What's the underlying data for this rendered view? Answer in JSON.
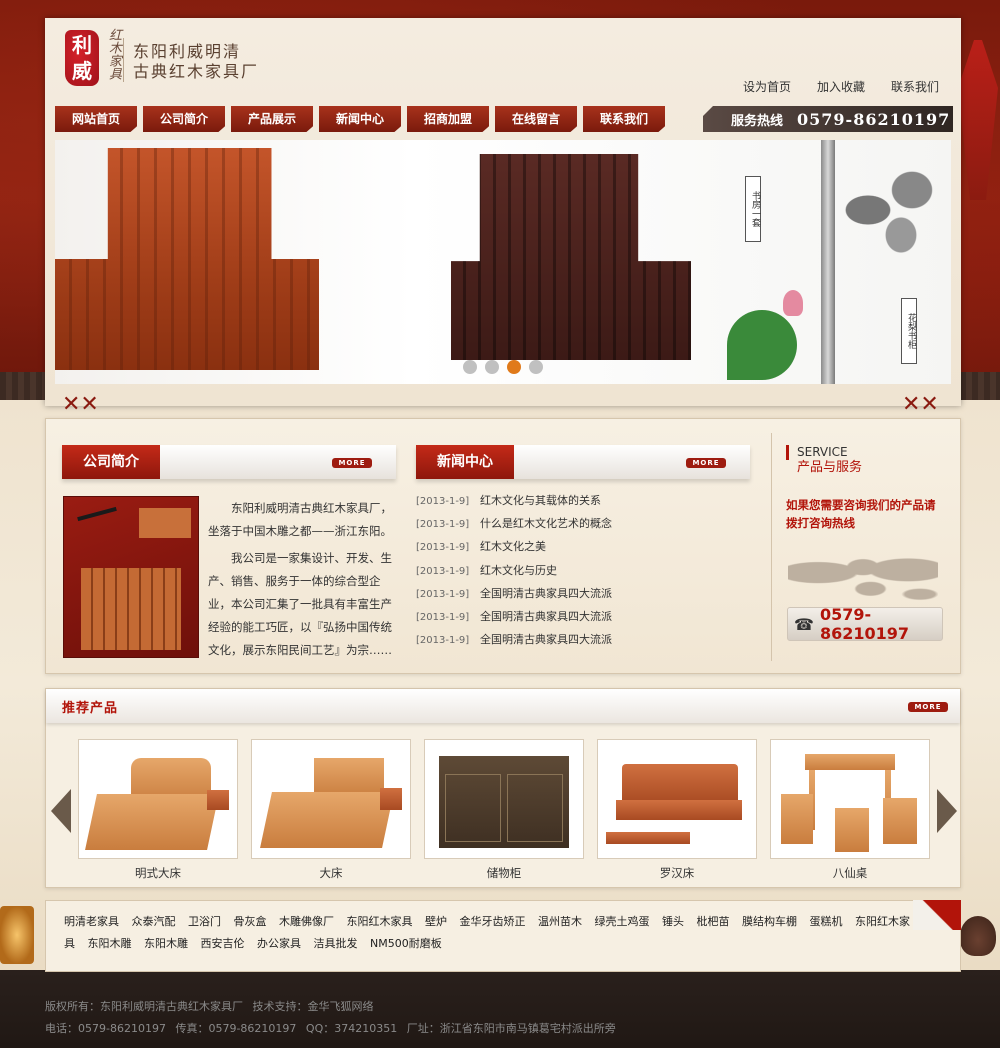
{
  "colors": {
    "accent": "#b2140a",
    "nav_red": "#8e170c",
    "page_bg": "#f1e6d2",
    "footer_bg": "#231a16"
  },
  "brand": {
    "seal_text": "利威",
    "script_text": "红木家具",
    "line1": "东阳利威明清",
    "line2": "古典红木家具厂"
  },
  "top_links": [
    "设为首页",
    "加入收藏",
    "联系我们"
  ],
  "nav": [
    "网站首页",
    "公司简介",
    "产品展示",
    "新闻中心",
    "招商加盟",
    "在线留言",
    "联系我们"
  ],
  "hotline": {
    "label": "服务热线",
    "number": "0579-86210197"
  },
  "banner": {
    "tag1": "书房一套",
    "tag2": "花梨书柜",
    "dots": 4,
    "active_dot": 3
  },
  "about": {
    "title": "公司简介",
    "more": "MORE",
    "para1": "东阳利威明清古典红木家具厂，坐落于中国木雕之都——浙江东阳。",
    "para2": "我公司是一家集设计、开发、生产、销售、服务于一体的综合型企业，本公司汇集了一批具有丰富生产经验的能工巧匠，以『弘扬中国传统文化，展示东阳民间工艺』为宗……"
  },
  "news": {
    "title": "新闻中心",
    "more": "MORE",
    "items": [
      {
        "date": "[2013-1-9]",
        "title": "红木文化与其载体的关系"
      },
      {
        "date": "[2013-1-9]",
        "title": "什么是红木文化艺术的概念"
      },
      {
        "date": "[2013-1-9]",
        "title": "红木文化之美"
      },
      {
        "date": "[2013-1-9]",
        "title": "红木文化与历史"
      },
      {
        "date": "[2013-1-9]",
        "title": "全国明清古典家具四大流派"
      },
      {
        "date": "[2013-1-9]",
        "title": "全国明清古典家具四大流派"
      },
      {
        "date": "[2013-1-9]",
        "title": "全国明清古典家具四大流派"
      }
    ]
  },
  "service": {
    "en": "SERVICE",
    "cn": "产品与服务",
    "consult": "如果您需要咨询我们的产品请拨打咨询热线",
    "phone": "0579-86210197"
  },
  "products": {
    "title": "推荐产品",
    "more": "MORE",
    "items": [
      {
        "name": "明式大床",
        "icon": "bed-icon"
      },
      {
        "name": "大床",
        "icon": "bed-icon"
      },
      {
        "name": "储物柜",
        "icon": "cabinet-icon"
      },
      {
        "name": "罗汉床",
        "icon": "daybed-icon"
      },
      {
        "name": "八仙桌",
        "icon": "table-icon"
      }
    ]
  },
  "links": [
    "明清老家具",
    "众泰汽配",
    "卫浴门",
    "骨灰盒",
    "木雕佛像厂",
    "东阳红木家具",
    "壁炉",
    "金华牙齿矫正",
    "温州苗木",
    "绿壳土鸡蛋",
    "锤头",
    "枇杷苗",
    "膜结构车棚",
    "蛋糕机",
    "东阳红木家具",
    "东阳木雕",
    "东阳木雕",
    "西安吉伦",
    "办公家具",
    "洁具批发",
    "NM500耐磨板"
  ],
  "footer": {
    "copyright": "版权所有：东阳利威明清古典红木家具厂",
    "support": "技术支持：金华飞狐网络",
    "tel": "电话：0579-86210197",
    "fax": "传真：0579-86210197",
    "qq": "QQ：374210351",
    "address": "厂址：浙江省东阳市南马镇葛宅村派出所旁"
  }
}
